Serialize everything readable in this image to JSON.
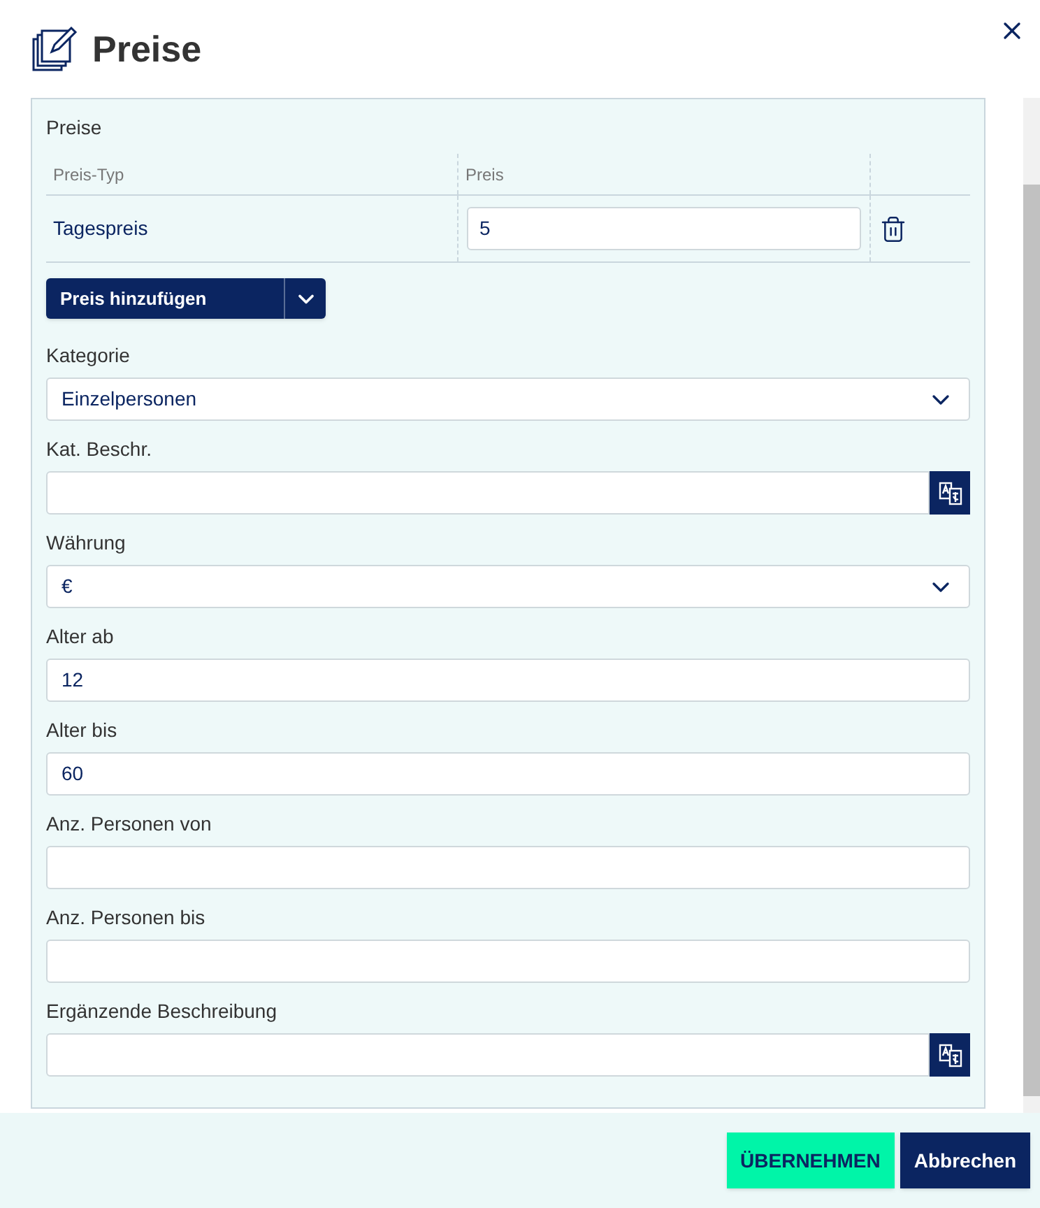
{
  "dialog": {
    "title": "Preise"
  },
  "prices": {
    "label": "Preise",
    "columns": [
      "Preis-Typ",
      "Preis"
    ],
    "rows": [
      {
        "type": "Tagespreis",
        "price": "5"
      }
    ],
    "add_button": "Preis hinzufügen"
  },
  "fields": [
    {
      "kind": "select",
      "label": "Kategorie",
      "value": "Einzelpersonen"
    },
    {
      "kind": "translate",
      "label": "Kat. Beschr."
    },
    {
      "kind": "select",
      "label": "Währung",
      "value": "€"
    },
    {
      "kind": "text",
      "label": "Alter ab",
      "value": "12"
    },
    {
      "kind": "text",
      "label": "Alter bis",
      "value": "60"
    },
    {
      "kind": "text",
      "label": "Anz. Personen von"
    },
    {
      "kind": "text",
      "label": "Anz. Personen bis"
    },
    {
      "kind": "translate",
      "label": "Ergänzende Beschreibung"
    }
  ],
  "footer": {
    "buttons": [
      {
        "kind": "primary",
        "label": "ÜBERNEHMEN"
      },
      {
        "kind": "secondary",
        "label": "Abbrechen"
      }
    ]
  }
}
